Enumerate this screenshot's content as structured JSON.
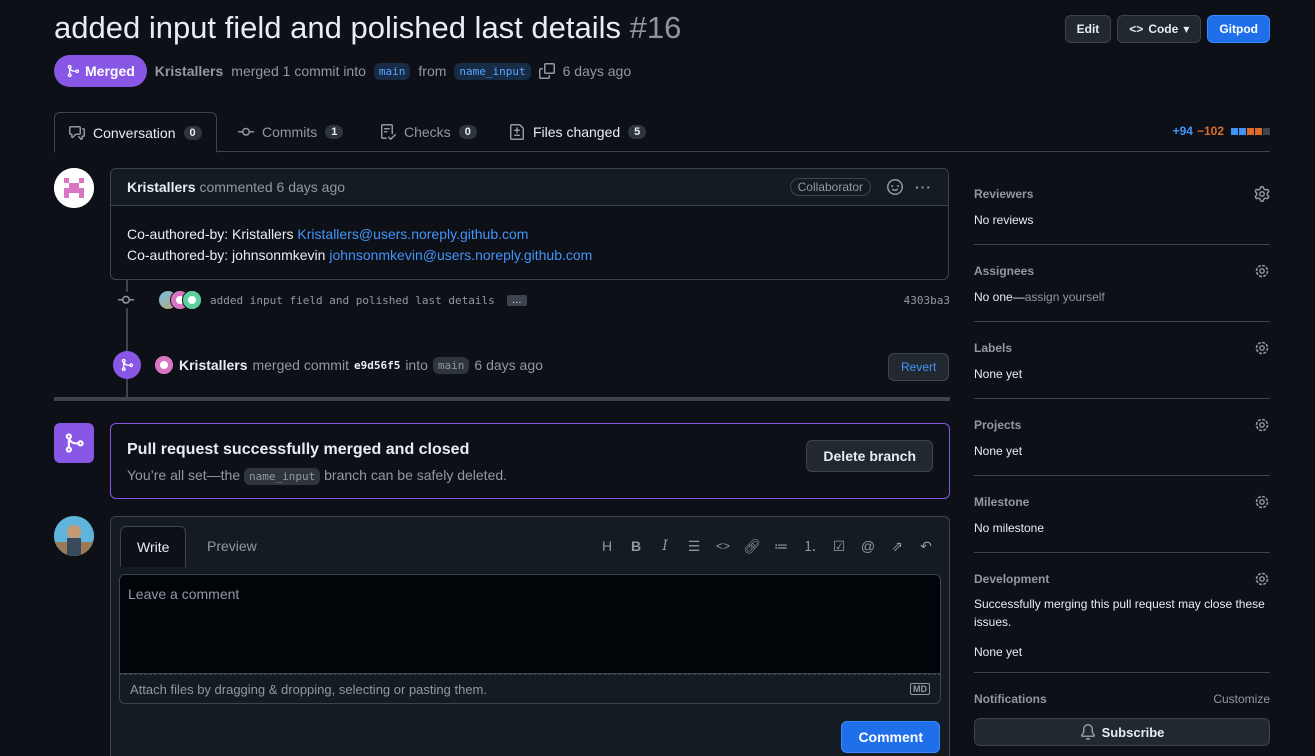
{
  "header": {
    "title": "added input field and polished last details",
    "number": "#16",
    "edit_label": "Edit",
    "code_label": "Code",
    "gitpod_label": "Gitpod"
  },
  "state": {
    "badge": "Merged",
    "author": "Kristallers",
    "text_merged": "merged 1 commit into",
    "base_branch": "main",
    "text_from": "from",
    "head_branch": "name_input",
    "time": "6 days ago"
  },
  "tabs": [
    {
      "label": "Conversation",
      "count": "0"
    },
    {
      "label": "Commits",
      "count": "1"
    },
    {
      "label": "Checks",
      "count": "0"
    },
    {
      "label": "Files changed",
      "count": "5"
    }
  ],
  "diffstat": {
    "additions": "+94",
    "deletions": "−102"
  },
  "comment": {
    "author": "Kristallers",
    "meta": "commented 6 days ago",
    "role": "Collaborator",
    "line1_prefix": "Co-authored-by: Kristallers",
    "line1_email": "Kristallers@users.noreply.github.com",
    "line2_prefix": "Co-authored-by: johnsonmkevin",
    "line2_email": "johnsonmkevin@users.noreply.github.com"
  },
  "commit": {
    "message": "added input field and polished last details",
    "ellipsis": "…",
    "sha": "4303ba3"
  },
  "merge_event": {
    "author": "Kristallers",
    "text_merged": "merged commit",
    "sha": "e9d56f5",
    "text_into": "into",
    "branch": "main",
    "time": "6 days ago",
    "revert_label": "Revert"
  },
  "merged_box": {
    "title": "Pull request successfully merged and closed",
    "sub_prefix": "You’re all set—the",
    "branch": "name_input",
    "sub_suffix": "branch can be safely deleted.",
    "delete_label": "Delete branch"
  },
  "editor": {
    "write_tab": "Write",
    "preview_tab": "Preview",
    "placeholder": "Leave a comment",
    "attach_text": "Attach files by dragging & dropping, selecting or pasting them.",
    "md_badge": "MD",
    "comment_button": "Comment",
    "toolbar": [
      "heading-icon",
      "bold-icon",
      "italic-icon",
      "quote-icon",
      "code-icon",
      "link-icon",
      "unordered-list-icon",
      "ordered-list-icon",
      "task-list-icon",
      "mention-icon",
      "reference-icon",
      "reply-icon"
    ]
  },
  "sidebar": {
    "reviewers": {
      "title": "Reviewers",
      "value": "No reviews"
    },
    "assignees": {
      "title": "Assignees",
      "value_prefix": "No one—",
      "value_link": "assign yourself"
    },
    "labels": {
      "title": "Labels",
      "value": "None yet"
    },
    "projects": {
      "title": "Projects",
      "value": "None yet"
    },
    "milestone": {
      "title": "Milestone",
      "value": "No milestone"
    },
    "development": {
      "title": "Development",
      "desc": "Successfully merging this pull request may close these issues.",
      "value": "None yet"
    },
    "notifications": {
      "title": "Notifications",
      "customize": "Customize",
      "subscribe": "Subscribe"
    }
  },
  "colors": {
    "merged": "#8957e5",
    "link": "#4493f8",
    "primary": "#1f6feb"
  }
}
